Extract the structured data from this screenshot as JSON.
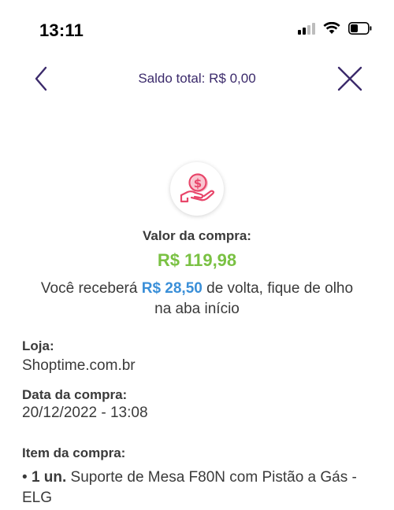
{
  "status_bar": {
    "time": "13:11"
  },
  "nav": {
    "balance_label": "Saldo total: R$ 0,00"
  },
  "purchase": {
    "label": "Valor da compra:",
    "value": "R$ 119,98",
    "cashback_prefix": "Você receberá ",
    "cashback_amount": "R$ 28,50",
    "cashback_suffix": " de volta, fique de olho na aba início"
  },
  "details": {
    "store_label": "Loja:",
    "store_value": "Shoptime.com.br",
    "date_label": "Data da compra:",
    "date_value": "20/12/2022 - 13:08",
    "item_label": "Item da compra:",
    "item_bullet": "• ",
    "item_qty": "1 un.",
    "item_name": " Suporte de Mesa F80N com Pistão a Gás - ELG"
  },
  "colors": {
    "nav_accent": "#3b2a6b",
    "purchase_value": "#7ac143",
    "cashback_amount": "#3a8fd8",
    "icon_accent": "#e8466a"
  }
}
